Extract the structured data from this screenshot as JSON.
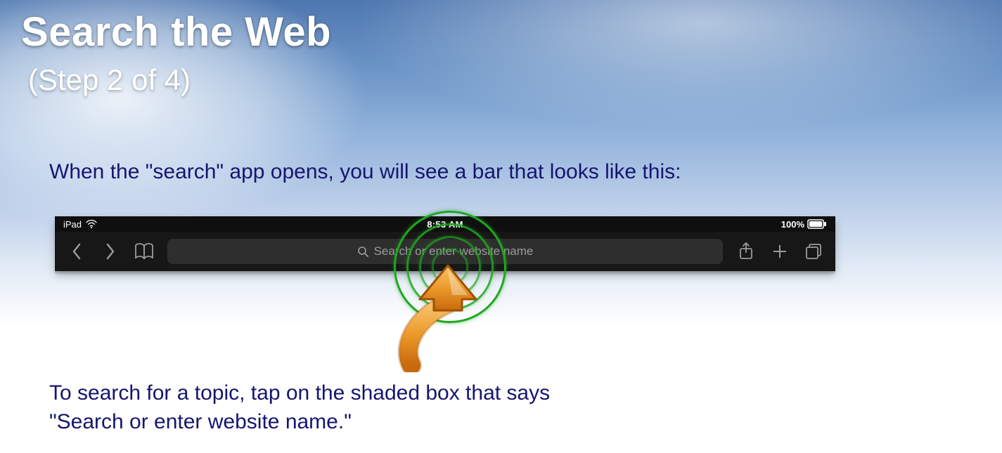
{
  "title": "Search the Web",
  "subtitle": "(Step 2 of 4)",
  "intro_text": "When the \"search\" app opens, you will see a bar that looks like this:",
  "instruction_line1": "To search for a topic, tap on the shaded box that says",
  "instruction_line2": "\"Search or enter website name.\"",
  "safari_bar": {
    "device_label": "iPad",
    "time": "8:53 AM",
    "battery_percent": "100%",
    "search_placeholder": "Search or enter website name",
    "icons": {
      "wifi": "wifi-icon",
      "battery": "battery-icon",
      "back": "chevron-left-icon",
      "forward": "chevron-right-icon",
      "bookmarks": "book-icon",
      "share": "share-icon",
      "new_tab": "plus-icon",
      "tabs": "tabs-icon",
      "search": "magnifier-icon"
    }
  },
  "callout": {
    "ripple_color": "#1fa81f",
    "arrow_color_top": "#f7b24a",
    "arrow_color_bottom": "#d97a12"
  }
}
